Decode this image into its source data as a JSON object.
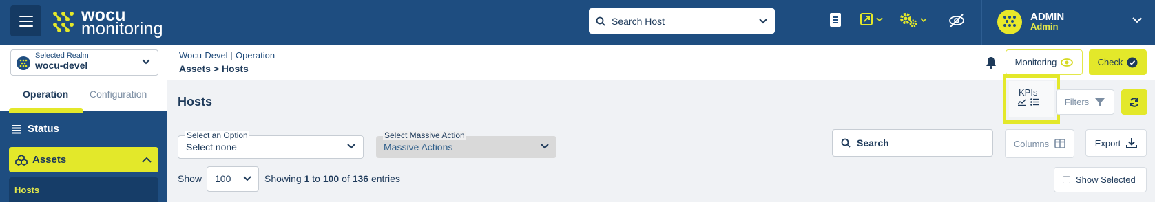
{
  "brand": {
    "line1": "wocu",
    "line2": "monitoring"
  },
  "topbar": {
    "search_placeholder": "Search Host",
    "admin": {
      "name": "ADMIN",
      "role": "Admin"
    }
  },
  "realm": {
    "caption": "Selected Realm",
    "value": "wocu-devel"
  },
  "breadcrumb": {
    "realm": "Wocu-Devel",
    "section": "Operation",
    "path": "Assets > Hosts"
  },
  "header_actions": {
    "monitoring_label": "Monitoring",
    "check_label": "Check"
  },
  "sidebar": {
    "tabs": [
      {
        "label": "Operation"
      },
      {
        "label": "Configuration"
      }
    ],
    "status_label": "Status",
    "assets_label": "Assets",
    "hosts_label": "Hosts"
  },
  "main": {
    "title": "Hosts",
    "kpis_label": "KPIs",
    "filters_label": "Filters",
    "option_select": {
      "caption": "Select an Option",
      "value": "Select none"
    },
    "massive_select": {
      "caption": "Select Massive Action",
      "value": "Massive Actions"
    },
    "search_label": "Search",
    "columns_label": "Columns",
    "export_label": "Export",
    "show_label": "Show",
    "page_size": "100",
    "entries": {
      "prefix": "Showing",
      "from": "1",
      "to_word": "to",
      "to": "100",
      "of_word": "of",
      "total": "136",
      "suffix": "entries"
    },
    "show_selected_label": "Show Selected"
  },
  "colors": {
    "navy": "#1e4d80",
    "accent": "#e3e82a",
    "text": "#1e3a5a"
  }
}
